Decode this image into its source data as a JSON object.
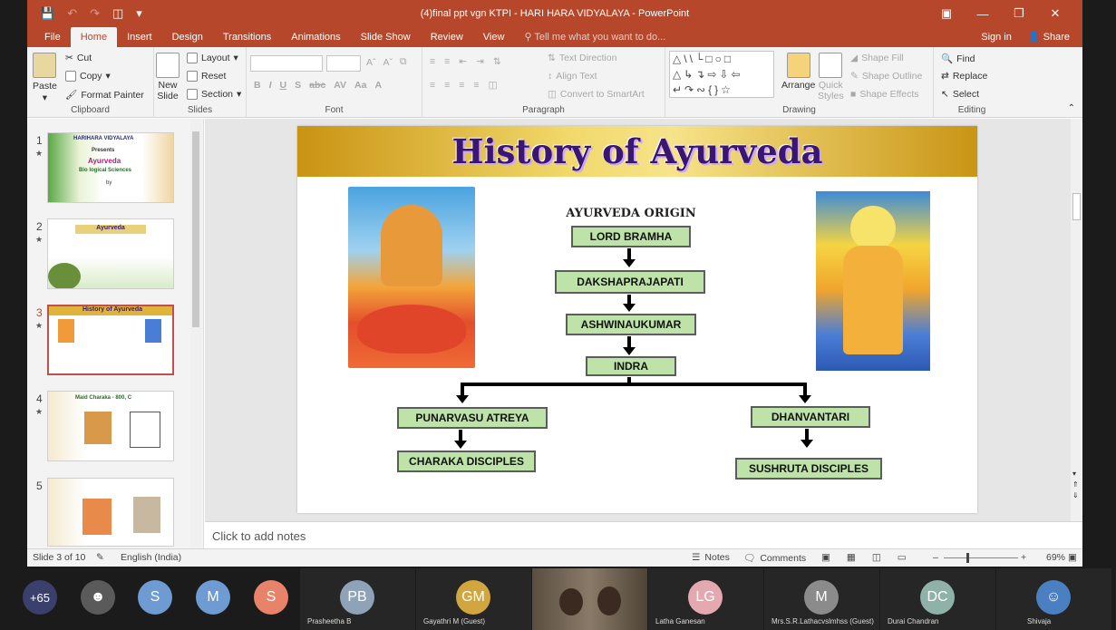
{
  "window": {
    "title": "(4)final ppt vgn KTPI - HARI HARA VIDYALAYA - PowerPoint"
  },
  "tabs": [
    "File",
    "Home",
    "Insert",
    "Design",
    "Transitions",
    "Animations",
    "Slide Show",
    "Review",
    "View"
  ],
  "active_tab": "Home",
  "tell_me": "Tell me what you want to do...",
  "sign_in": "Sign in",
  "share": "Share",
  "ribbon": {
    "clipboard": {
      "paste": "Paste",
      "cut": "Cut",
      "copy": "Copy",
      "format_painter": "Format Painter",
      "label": "Clipboard"
    },
    "slides": {
      "new_slide_1": "New",
      "new_slide_2": "Slide",
      "layout": "Layout",
      "reset": "Reset",
      "section": "Section",
      "label": "Slides"
    },
    "font": {
      "label": "Font"
    },
    "paragraph": {
      "text_direction": "Text Direction",
      "align_text": "Align Text",
      "convert": "Convert to SmartArt",
      "label": "Paragraph"
    },
    "drawing": {
      "arrange": "Arrange",
      "quick_1": "Quick",
      "quick_2": "Styles",
      "shape_fill": "Shape Fill",
      "shape_outline": "Shape Outline",
      "shape_effects": "Shape Effects",
      "label": "Drawing"
    },
    "editing": {
      "find": "Find",
      "replace": "Replace",
      "select": "Select",
      "label": "Editing"
    }
  },
  "thumbnails": {
    "numbers": [
      "1",
      "2",
      "3",
      "4",
      "5"
    ],
    "t1": {
      "l1": "HARIHARA VIDYALAYA",
      "l2": "Presents",
      "l3": "Ayurveda",
      "l4": "Bio logical Sciences",
      "l5": "by"
    },
    "t2": {
      "l1": "Ayurveda"
    },
    "t3": {
      "l1": "History of Ayurveda"
    },
    "t4": {
      "l1": "Maid Charaka - 800, C"
    }
  },
  "slide": {
    "title": "History of Ayurveda",
    "origin": "AYURVEDA ORIGIN",
    "nodes": {
      "bramha": "LORD BRAMHA",
      "daksha": "DAKSHAPRAJAPATI",
      "ashwin": "ASHWINAUKUMAR",
      "indra": "INDRA",
      "punar": "PUNARVASU ATREYA",
      "dhanv": "DHANVANTARI",
      "charaka": "CHARAKA DISCIPLES",
      "sushruta": "SUSHRUTA DISCIPLES"
    }
  },
  "notes_placeholder": "Click to add notes",
  "status": {
    "slide_of": "Slide 3 of 10",
    "language": "English (India)",
    "notes": "Notes",
    "comments": "Comments",
    "zoom": "69%"
  },
  "participants": [
    {
      "initials": "+65",
      "name": "",
      "color": "#3b3f6b"
    },
    {
      "initials": "",
      "name": "",
      "color": "#5a5a5a"
    },
    {
      "initials": "S",
      "name": "",
      "color": "#6e9bd1"
    },
    {
      "initials": "M",
      "name": "",
      "color": "#6e9bd1"
    },
    {
      "initials": "S",
      "name": "",
      "color": "#e8836a"
    },
    {
      "initials": "PB",
      "name": "Prasheetha B",
      "color": "#8fa3b8"
    },
    {
      "initials": "GM",
      "name": "Gayathri M (Guest)",
      "color": "#d2a63e"
    },
    {
      "initials": "",
      "name": "",
      "color": "#6b5b4b"
    },
    {
      "initials": "LG",
      "name": "Latha Ganesan",
      "color": "#e4a8b0"
    },
    {
      "initials": "M",
      "name": "Mrs.S.R.Lathacvslmhss (Guest)",
      "color": "#8b8b8b"
    },
    {
      "initials": "DC",
      "name": "Durai Chandran",
      "color": "#8fb2a8"
    },
    {
      "initials": "",
      "name": "Shivaja",
      "color": "#4a7fc1"
    }
  ]
}
